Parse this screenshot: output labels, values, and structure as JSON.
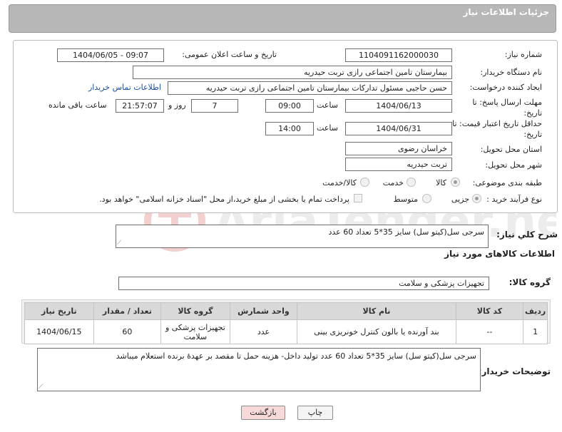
{
  "header": {
    "title": "جزئیات اطلاعات نیاز"
  },
  "form": {
    "need_number_label": "شماره نیاز:",
    "need_number": "1104091162000030",
    "announce_label": "تاریخ و ساعت اعلان عمومی:",
    "announce_value": "1404/06/05 - 09:07",
    "buyer_org_label": "نام دستگاه خریدار:",
    "buyer_org": "بیمارستان تامین اجتماعی رازی تربت حیدریه",
    "creator_label": "ایجاد کننده درخواست:",
    "creator": "حسن حاجیی مسئول تدارکات بیمارستان تامین اجتماعی رازی تربت حیدریه",
    "contact_link": "اطلاعات تماس خریدار",
    "deadline_label": "مهلت ارسال پاسخ: تا تاریخ:",
    "deadline_date": "1404/06/13",
    "time_label": "ساعت",
    "deadline_time": "09:00",
    "days_value": "7",
    "days_label": "روز و",
    "remaining_time": "21:57:07",
    "remaining_label": "ساعت باقی مانده",
    "min_price_label": "حداقل تاریخ اعتبار قیمت: تا تاریخ:",
    "min_price_date": "1404/06/31",
    "min_price_time": "14:00",
    "province_label": "استان محل تحویل:",
    "province": "خراسان رضوی",
    "city_label": "شهر محل تحویل:",
    "city": "تربت حیدریه",
    "category_label": "طبقه بندی موضوعی:",
    "category_options": [
      "کالا",
      "خدمت",
      "کالا/خدمت"
    ],
    "purchase_type_label": "نوع فرآیند خرید :",
    "purchase_options": [
      "جزیی",
      "متوسط"
    ],
    "payment_note": "پرداخت تمام یا بخشی از مبلغ خرید،از محل \"اسناد خزانه اسلامی\" خواهد بود."
  },
  "summary": {
    "label": "شرح کلي نياز:",
    "text": "سرجی سل(کیتو سل) سایز 35*5 تعداد 60 عدد"
  },
  "goods": {
    "section_title": "اطلاعات کالاهای مورد نیاز",
    "group_label": "گروه کالا:",
    "group_value": "تجهیزات پزشکی و سلامت",
    "columns": [
      "ردیف",
      "کد کالا",
      "نام کالا",
      "واحد شمارش",
      "گروه کالا",
      "تعداد / مقدار",
      "تاریخ نیاز"
    ],
    "rows": [
      {
        "row": "1",
        "code": "--",
        "name": "بند آورنده یا بالون کنترل خونریزی بینی",
        "unit": "عدد",
        "group": "تجهیزات پزشکی و سلامت",
        "qty": "60",
        "date": "1404/06/15"
      }
    ]
  },
  "buyer_notes": {
    "label": "توضیحات خریدار:",
    "text": "سرجی سل(کیتو سل) سایز 35*5 تعداد 60 عدد تولید داخل- هزینه حمل تا مقصد بر عهدهٔ برنده استعلام میباشد"
  },
  "buttons": {
    "print": "چاپ",
    "back": "بازگشت"
  },
  "watermark": {
    "text": "AriaTender.neT"
  },
  "colors": {
    "header_bg": "#b7b7b7",
    "table_header_bg": "#d9d9d9",
    "back_button_bg": "#f7d9d9",
    "link": "#1a4fa0"
  }
}
